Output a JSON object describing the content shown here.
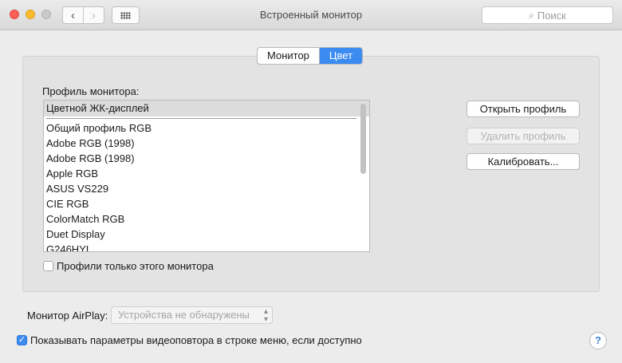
{
  "window": {
    "title": "Встроенный монитор",
    "nav_back": "‹",
    "nav_forward": "›",
    "search_icon": "⌕",
    "search_placeholder": "Поиск"
  },
  "tabs": [
    {
      "label": "Монитор",
      "active": false
    },
    {
      "label": "Цвет",
      "active": true
    }
  ],
  "profiles": {
    "label": "Профиль монитора:",
    "selected": "Цветной ЖК-дисплей",
    "items": [
      "Общий профиль RGB",
      "Adobe RGB (1998)",
      "Adobe RGB (1998)",
      "Apple RGB",
      "ASUS VS229",
      "CIE RGB",
      "ColorMatch RGB",
      "Duet Display",
      "G246HYL"
    ],
    "only_this_monitor": {
      "label": "Профили только этого монитора",
      "checked": false
    }
  },
  "buttons": {
    "open": "Открыть профиль",
    "delete": "Удалить профиль",
    "calibrate": "Калибровать..."
  },
  "airplay": {
    "label": "Монитор AirPlay:",
    "value": "Устройства не обнаружены",
    "arrows": "⌃⌄"
  },
  "mirroring": {
    "label": "Показывать параметры видеоповтора в строке меню, если доступно",
    "checked": true,
    "checkmark": "✓"
  },
  "help": "?",
  "colors": {
    "accent": "#3b8bf0",
    "close": "#fc5f57",
    "minimize": "#fdbc2e"
  }
}
